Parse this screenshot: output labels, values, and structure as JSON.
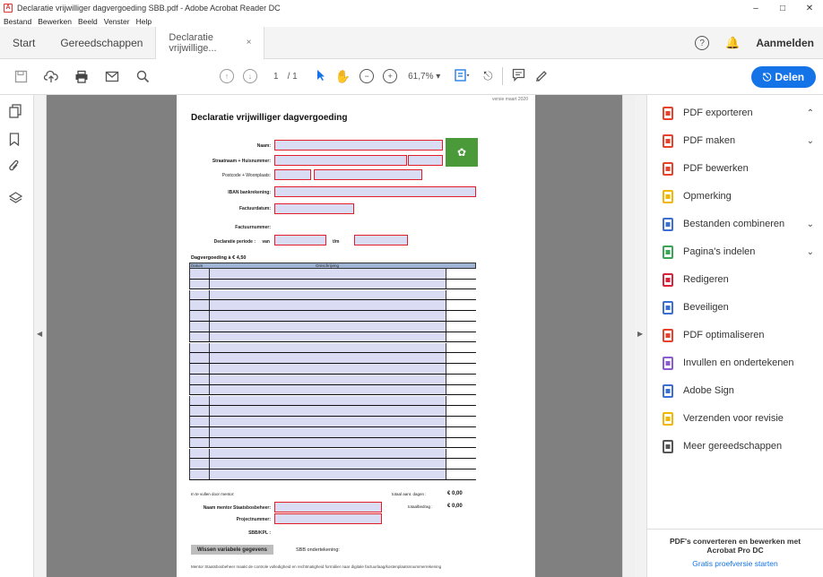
{
  "window": {
    "title": "Declaratie vrijwilliger dagvergoeding SBB.pdf - Adobe Acrobat Reader DC",
    "controls": [
      "–",
      "□",
      "✕"
    ]
  },
  "menu": [
    "Bestand",
    "Bewerken",
    "Beeld",
    "Venster",
    "Help"
  ],
  "tabs": {
    "start": "Start",
    "tools": "Gereedschappen",
    "document": "Declaratie vrijwillige...",
    "close": "×"
  },
  "header_right": {
    "help": "?",
    "signin": "Aanmelden"
  },
  "toolbar": {
    "page_current": "1",
    "page_total": "/ 1",
    "zoom": "61,7%",
    "share": "Delen"
  },
  "right_panel": {
    "items": [
      {
        "label": "PDF exporteren",
        "icon": "export-pdf-icon",
        "color": "#e8412c",
        "chevron": "⌃"
      },
      {
        "label": "PDF maken",
        "icon": "create-pdf-icon",
        "color": "#e8412c",
        "chevron": "⌄"
      },
      {
        "label": "PDF bewerken",
        "icon": "edit-pdf-icon",
        "color": "#e8412c",
        "chevron": ""
      },
      {
        "label": "Opmerking",
        "icon": "comment-icon",
        "color": "#f2b705",
        "chevron": ""
      },
      {
        "label": "Bestanden combineren",
        "icon": "combine-files-icon",
        "color": "#3b6fd4",
        "chevron": "⌄"
      },
      {
        "label": "Pagina's indelen",
        "icon": "organize-pages-icon",
        "color": "#3aa655",
        "chevron": "⌄"
      },
      {
        "label": "Redigeren",
        "icon": "redact-icon",
        "color": "#d9233a",
        "chevron": ""
      },
      {
        "label": "Beveiligen",
        "icon": "protect-icon",
        "color": "#3b6fd4",
        "chevron": ""
      },
      {
        "label": "PDF optimaliseren",
        "icon": "optimize-pdf-icon",
        "color": "#e8412c",
        "chevron": ""
      },
      {
        "label": "Invullen en ondertekenen",
        "icon": "fill-sign-icon",
        "color": "#8a5bd1",
        "chevron": ""
      },
      {
        "label": "Adobe Sign",
        "icon": "adobe-sign-icon",
        "color": "#3b6fd4",
        "chevron": ""
      },
      {
        "label": "Verzenden voor revisie",
        "icon": "send-review-icon",
        "color": "#f2b705",
        "chevron": ""
      },
      {
        "label": "Meer gereedschappen",
        "icon": "more-tools-icon",
        "color": "#555555",
        "chevron": ""
      }
    ],
    "footer_text": "PDF's converteren en bewerken met Acrobat Pro DC",
    "footer_link": "Gratis proefversie starten"
  },
  "pdf": {
    "version": "versie maart 2020",
    "title": "Declaratie vrijwilliger dagvergoeding",
    "fields": {
      "name": "Naam:",
      "street": "Straatnaam + Huisnummer:",
      "postal": "Postcode + Woonplaats:",
      "iban": "IBAN bankrekening:",
      "invoice_date": "Factuurdatum:",
      "invoice_nr": "Factuurnummer:",
      "period": "Declaratie periode :",
      "from": "van",
      "to": "t/m"
    },
    "section": "Dagvergoeding à € 4,50",
    "grid_head": {
      "date": "Datum",
      "desc": "Omschrijving"
    },
    "footer": {
      "signature": "In te vullen door mentor:",
      "total_label": "totaal aant. dagen :",
      "total_val": "€ 0,00",
      "amount_label": "totaalbedrag :",
      "amount_val": "€ 0,00",
      "mentor_label": "Naam mentor Staatsbosbeheer:",
      "project_label": "Projectnummer:",
      "kostenplaats": "SBB/KPL :",
      "wipe": "Wissen variabele gegevens",
      "sbb_sign": "SBB ondertekening:",
      "bottom_note": "Mentor Staatsbosbeheer maakt de controle volledigheid en rechtmatigheid formálier naar digitale factuurlaag/kostenplaatsnnummerrekening"
    }
  }
}
